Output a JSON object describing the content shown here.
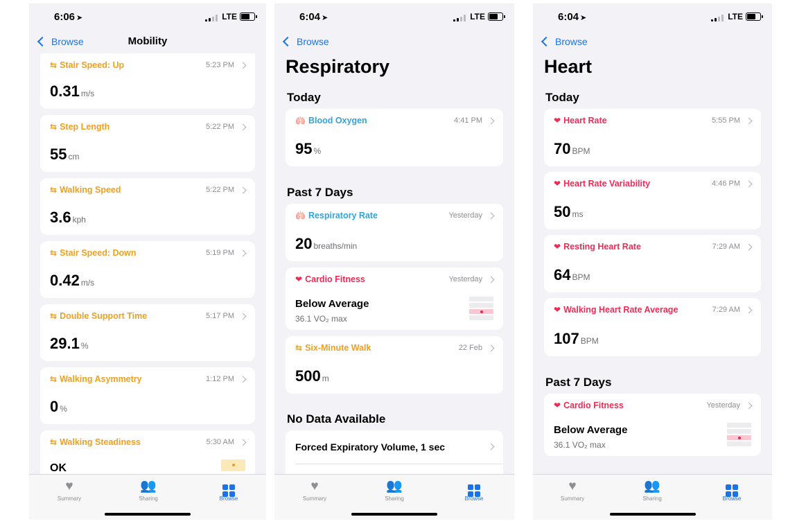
{
  "icons": {
    "mobility": "arrows-icon",
    "respiratory": "lungs-icon",
    "heart": "heart-icon"
  },
  "colors": {
    "mobility": "#f0a020",
    "respiratory": "#32a3d8",
    "heart": "#ee2b55",
    "accent": "#1a73e8"
  },
  "tabs": {
    "summary": "Summary",
    "sharing": "Sharing",
    "browse": "Browse"
  },
  "screens": [
    {
      "status": {
        "time": "6:06",
        "network": "LTE"
      },
      "back": "Browse",
      "title": "Mobility",
      "cards": [
        {
          "title": "Stair Speed: Up",
          "time": "5:23 PM",
          "value": "0.31",
          "unit": "m/s"
        },
        {
          "title": "Step Length",
          "time": "5:22 PM",
          "value": "55",
          "unit": "cm"
        },
        {
          "title": "Walking Speed",
          "time": "5:22 PM",
          "value": "3.6",
          "unit": "kph"
        },
        {
          "title": "Stair Speed: Down",
          "time": "5:19 PM",
          "value": "0.42",
          "unit": "m/s"
        },
        {
          "title": "Double Support Time",
          "time": "5:17 PM",
          "value": "29.1",
          "unit": "%"
        },
        {
          "title": "Walking Asymmetry",
          "time": "1:12 PM",
          "value": "0",
          "unit": "%"
        },
        {
          "title": "Walking Steadiness",
          "time": "5:30 AM",
          "value": "OK"
        }
      ]
    },
    {
      "status": {
        "time": "6:04",
        "network": "LTE"
      },
      "back": "Browse",
      "title": "Respiratory",
      "sections": {
        "today": "Today",
        "past7": "Past 7 Days",
        "nodata": "No Data Available"
      },
      "cards": [
        {
          "title": "Blood Oxygen",
          "time": "4:41 PM",
          "value": "95",
          "unit": "%"
        },
        {
          "title": "Respiratory Rate",
          "time": "Yesterday",
          "value": "20",
          "unit": "breaths/min"
        },
        {
          "title": "Cardio Fitness",
          "time": "Yesterday",
          "value": "Below Average",
          "sub": "36.1 VO₂ max"
        },
        {
          "title": "Six-Minute Walk",
          "time": "22 Feb",
          "value": "500",
          "unit": "m"
        }
      ],
      "nodata_items": [
        "Forced Expiratory Volume, 1 sec"
      ]
    },
    {
      "status": {
        "time": "6:04",
        "network": "LTE"
      },
      "back": "Browse",
      "title": "Heart",
      "sections": {
        "today": "Today",
        "past7": "Past 7 Days"
      },
      "cards": [
        {
          "title": "Heart Rate",
          "time": "5:55 PM",
          "value": "70",
          "unit": "BPM"
        },
        {
          "title": "Heart Rate Variability",
          "time": "4:46 PM",
          "value": "50",
          "unit": "ms"
        },
        {
          "title": "Resting Heart Rate",
          "time": "7:29 AM",
          "value": "64",
          "unit": "BPM"
        },
        {
          "title": "Walking Heart Rate Average",
          "time": "7:29 AM",
          "value": "107",
          "unit": "BPM"
        },
        {
          "title": "Cardio Fitness",
          "time": "Yesterday",
          "value": "Below Average",
          "sub": "36.1 VO₂ max"
        }
      ]
    }
  ]
}
